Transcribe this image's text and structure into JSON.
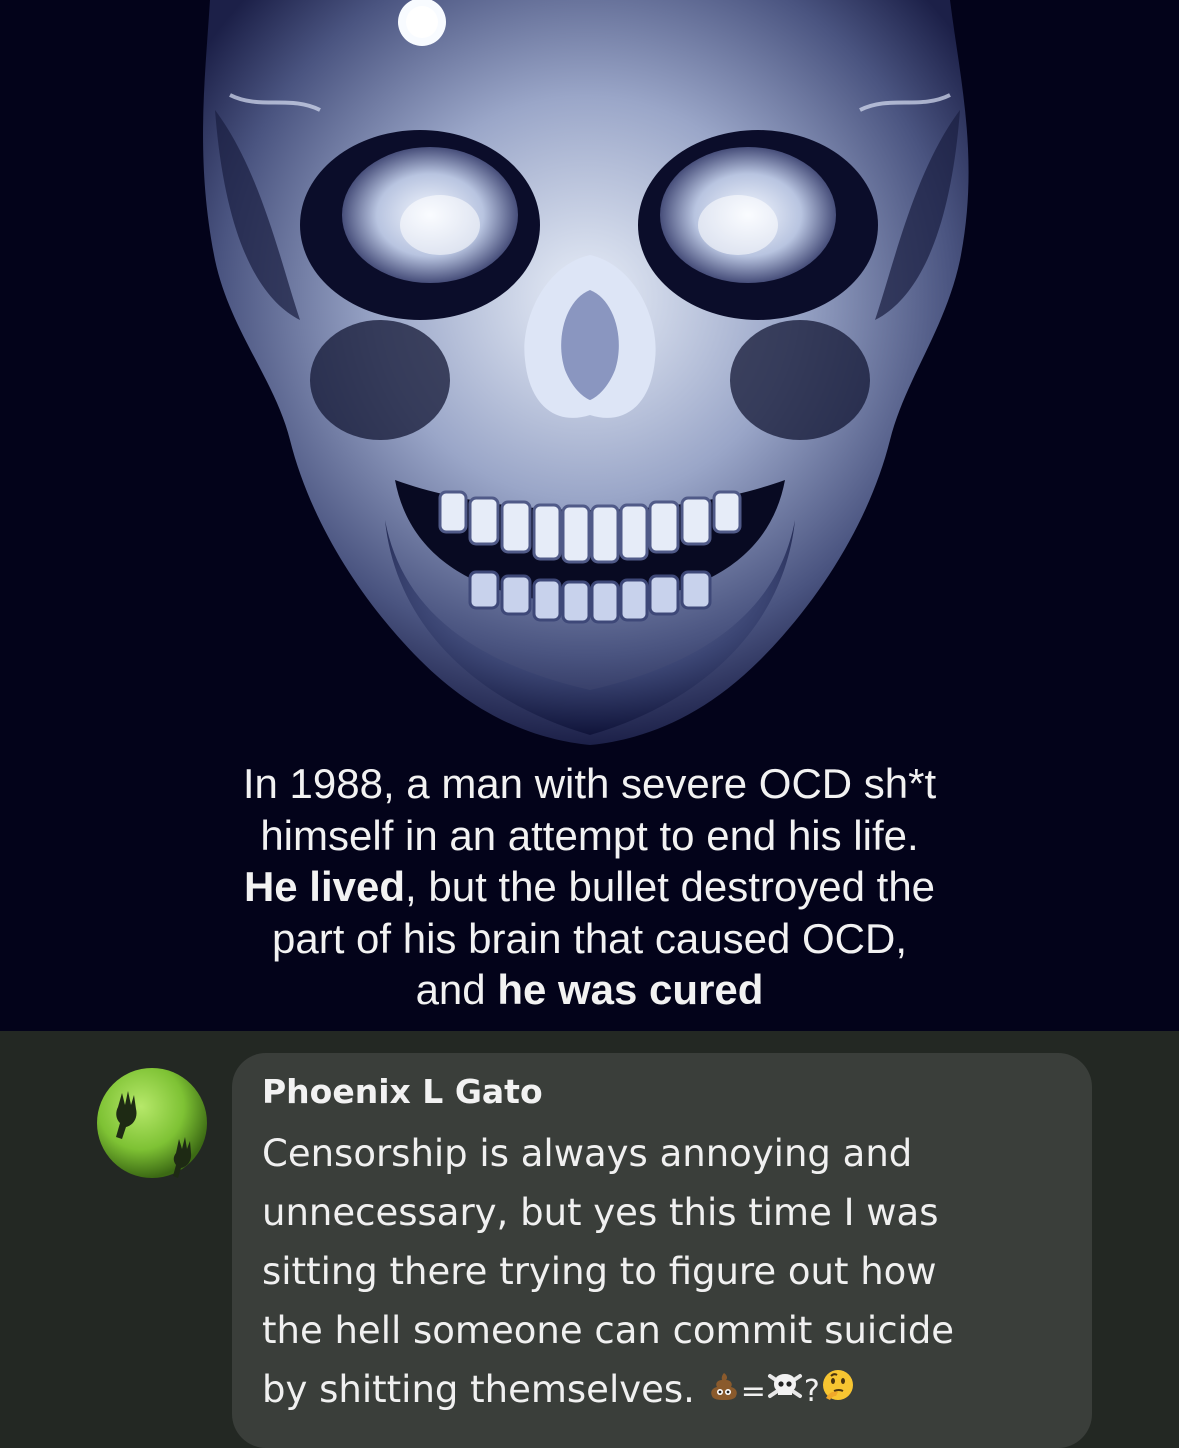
{
  "post": {
    "image_label": "skull-xray",
    "caption": {
      "line1": "In 1988, a man with severe OCD sh*t",
      "line2": "himself in an attempt to end his life.",
      "line3_bold": "He lived",
      "line3_rest": ", but the bullet destroyed the",
      "line4": "part of his brain that caused OCD,",
      "line5_pre": "and ",
      "line5_bold": "he was cured"
    }
  },
  "comment": {
    "author": "Phoenix L Gato",
    "avatar_icon": "green-ghost-hands-avatar",
    "lines": [
      "Censorship is always annoying and",
      "unnecessary, but yes this time I was",
      "sitting there trying to figure out how",
      "the hell someone can commit suicide",
      "by shitting themselves. "
    ],
    "emoji_equation": {
      "icons": [
        "poop-emoji",
        "skull-crossbones-emoji",
        "thinking-face-emoji"
      ],
      "eq": "=",
      "q": "?"
    }
  },
  "colors": {
    "post_bg": "#03031a",
    "comment_area_bg": "#232823",
    "bubble_bg": "#3a3e3a",
    "avatar_green": "#7ec234"
  }
}
